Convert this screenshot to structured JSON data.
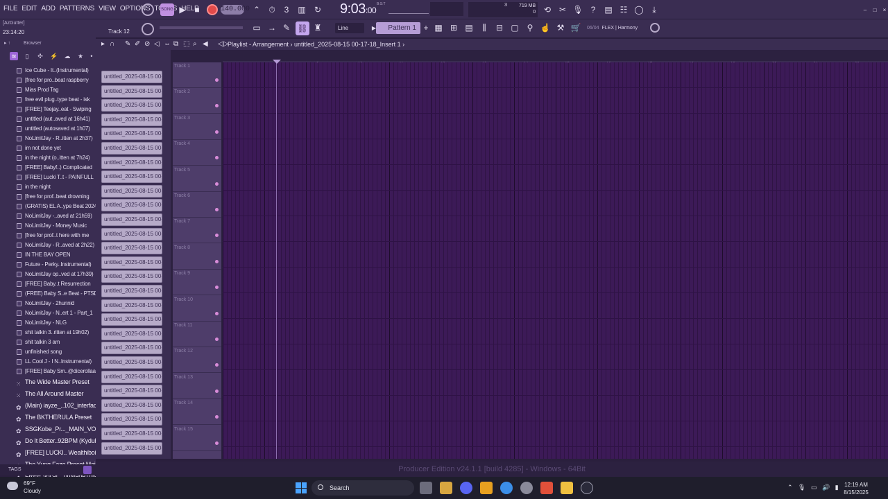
{
  "menu": [
    "FILE",
    "EDIT",
    "ADD",
    "PATTERNS",
    "VIEW",
    "OPTIONS",
    "TOOLS",
    "HELP"
  ],
  "transport": {
    "song_mode": "SONG",
    "tempo": "140.000",
    "time": "9:03",
    "time_small": ":00",
    "time_label": "B:S:T"
  },
  "monitor": {
    "cpu": "3",
    "voices": "0",
    "memory": "719 MB",
    "mem_sub": "0"
  },
  "hint": {
    "name": "[AzGutter]",
    "clock": "23:14:20",
    "track": "Track 12"
  },
  "snap": "Line",
  "pattern": "Pattern 1",
  "plugin": {
    "num": "06/04",
    "name": "FLEX | Harmony"
  },
  "browser": {
    "title": "Browser",
    "items": [
      "Ice Cube - It..(Instrumental)",
      "[free for pro..beat raspberry",
      "Mias Prod Tag",
      "free evil plug..type beat - isk",
      "[FREE] Teejay..eat - Swiping",
      "untitled (aut..aved at 16h41)",
      "untitled (autosaved at 1h07)",
      "NoLimitJay - R..itten at 2h37)",
      "im not done yet",
      "in the night (o..itten at 7h24)",
      "[FREE] Babyf..) Complicated",
      "[FREE] Lucki T..t - PAINFULL",
      "in the night",
      "[free for prof..beat drowning",
      "(GRATIS) EL A..ype Beat 2024",
      "NoLimitJay -..aved at 21h59)",
      "NoLimitJay - Money Music",
      "[free for prof..t here with me",
      "NoLimitJay - R..aved at 2h22)",
      "IN THE BAY OPEN",
      "Future - Perky..Instrumental)",
      "NoLimitJay op..ved at 17h39)",
      "[FREE] Baby..t Resurrection",
      "(FREE) Baby S..e Beat - PTSD",
      "NoLimitJay - 2hunnid",
      "NoLimitJay - N..ert 1 - Part_1",
      "NoLimitJay - NLG",
      "shit talkin 3..ritten at 19h02)",
      "shit talkin 3 am",
      "unfinished song",
      "LL Cool J - I N..Instrumental)",
      "[FREE] Baby Sm..@dicerollaa"
    ],
    "presets": [
      "The Wide Master Preset",
      "The All Around Master",
      "(Main) iayze_..102_interface",
      "The BKTHERULA Preset",
      "SSGKobe_Pr..._MAIN_VOCAL",
      "Do It Better..92BPM (Kyduh)",
      "[FREE] LUCKI..  Wealthiboi.)",
      "The Yung Fazo Preset Main",
      "FREE Vocal ...onMadeThis"
    ],
    "tags": "TAGS"
  },
  "playlist": {
    "title": "Playlist - Arrangement",
    "path": "untitled_2025-08-15 00-17-18_Insert 1",
    "clip_name": "untitled_2025-08-15 00-...",
    "clips_count_label": "",
    "tracks": [
      "Track 1",
      "Track 2",
      "Track 3",
      "Track 4",
      "Track 5",
      "Track 6",
      "Track 7",
      "Track 8",
      "Track 9",
      "Track 10",
      "Track 11",
      "Track 12",
      "Track 13",
      "Track 14",
      "Track 15"
    ],
    "ruler": [
      "9",
      "10",
      "11",
      "12",
      "13",
      "14",
      "15",
      "16",
      "17",
      "18",
      "19",
      "20",
      "21",
      "22",
      "23"
    ]
  },
  "status": "Producer Edition v24.1.1 [build 4285] - Windows - 64Bit",
  "taskbar": {
    "temp": "69°F",
    "cond": "Cloudy",
    "search": "Search",
    "time": "12:19 AM",
    "date": "8/15/2025"
  },
  "colors": {
    "accent": "#9d66d6",
    "grid": "#3c1a57",
    "clip": "#b6aac8"
  }
}
